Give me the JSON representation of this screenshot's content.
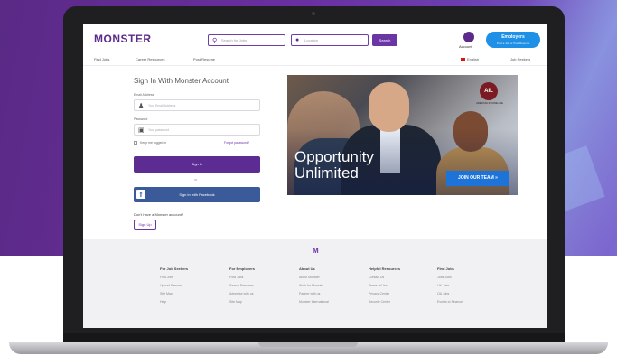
{
  "header": {
    "logo": "MONSTER",
    "search_placeholder": "Search for Jobs",
    "location_placeholder": "Location",
    "search_button": "Search",
    "account_label": "Account",
    "employers_button": {
      "line1": "Employers",
      "line2": "Post a Job or Post Resume"
    }
  },
  "nav": {
    "items": [
      "Find Jobs",
      "Career Resources",
      "Post Resume"
    ],
    "language": "English",
    "right_link": "Job Seekers"
  },
  "signin": {
    "title": "Sign In With Monster Account",
    "email_label": "Email Address",
    "email_placeholder": "Your Email Address",
    "password_label": "Password",
    "password_placeholder": "Your password",
    "keep_logged_in": "Keep me logged in",
    "forgot_password": "Forgot password?",
    "signin_button": "Sign In",
    "or_text": "or",
    "facebook_button": "Sign In with Facebook",
    "no_account_text": "Don't have a Monster account?",
    "signup_button": "Sign Up"
  },
  "promo": {
    "brand_mark": "AIL",
    "brand_text": "AMERICAN INCOME LIFE",
    "headline_line1": "Opportunity",
    "headline_line2": "Unlimited",
    "cta_button": "JOIN OUR TEAM"
  },
  "footer": {
    "logo": "M",
    "columns": [
      {
        "heading": "For Job Seekers",
        "links": [
          "Find Jobs",
          "Upload Resume",
          "Site Map",
          "Help"
        ]
      },
      {
        "heading": "For Employers",
        "links": [
          "Post Jobs",
          "Search Resumes",
          "Advertise with us",
          "Site Map"
        ]
      },
      {
        "heading": "About Us",
        "links": [
          "About Monster",
          "Work for Monster",
          "Partner with us",
          "Monster International"
        ]
      },
      {
        "heading": "Helpful Resources",
        "links": [
          "Contact Us",
          "Terms of Use",
          "Privacy Center",
          "Security Center"
        ]
      },
      {
        "heading": "Find Jobs",
        "links": [
          "Jobs Jobs",
          "UX Jobs",
          "QA Jobs",
          "Events to Finance"
        ]
      }
    ]
  },
  "colors": {
    "brand_purple": "#5d2c92",
    "employers_blue": "#1e90e6",
    "facebook_blue": "#3b5a9a",
    "cta_blue": "#1e73d8",
    "background_purple": "#6a2fa0"
  }
}
